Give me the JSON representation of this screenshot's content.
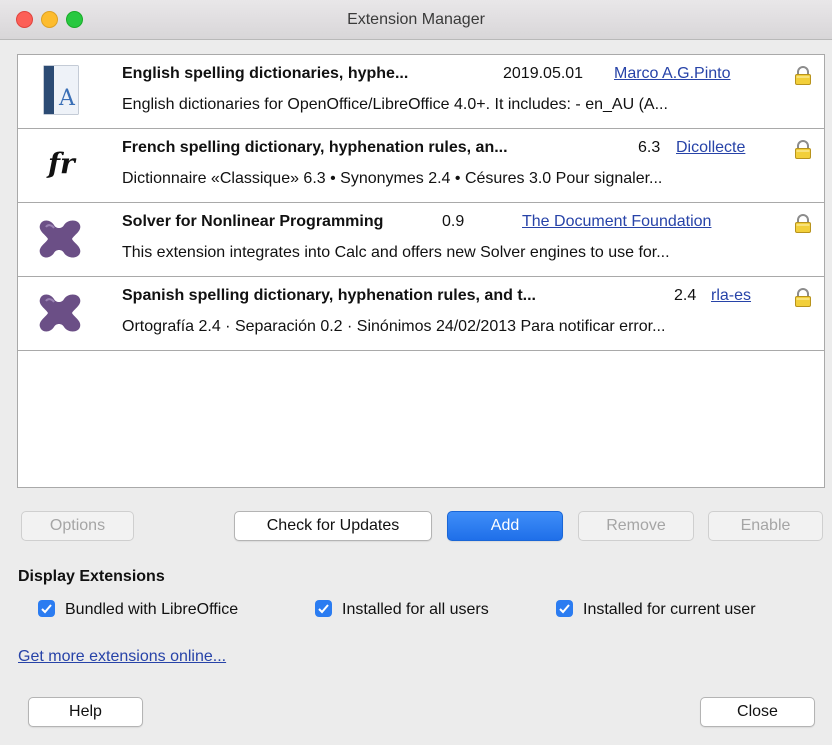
{
  "window": {
    "title": "Extension Manager"
  },
  "extensions": [
    {
      "name": "English spelling dictionaries, hyphe...",
      "version": "2019.05.01",
      "publisher": "Marco A.G.Pinto",
      "description": "English dictionaries for OpenOffice/LibreOffice 4.0+.  It includes: - en_AU (A...",
      "icon": "book-icon"
    },
    {
      "name": "French spelling dictionary, hyphenation rules, an...",
      "version": "6.3",
      "publisher": "Dicollecte",
      "description": "Dictionnaire «Classique» 6.3 • Synonymes 2.4 • Césures 3.0  Pour signaler...",
      "icon": "fr-icon",
      "icon_text": "fr"
    },
    {
      "name": "Solver for Nonlinear Programming",
      "version": "0.9",
      "publisher": "The Document Foundation",
      "description": "This extension integrates into Calc and offers new Solver engines to use for...",
      "icon": "puzzle-icon"
    },
    {
      "name": "Spanish spelling dictionary, hyphenation rules, and t...",
      "version": "2.4",
      "publisher": "rla-es",
      "description": "Ortografía 2.4 · Separación 0.2 · Sinónimos 24/02/2013  Para notificar error...",
      "icon": "puzzle-icon"
    }
  ],
  "buttons": {
    "options": "Options",
    "check_updates": "Check for Updates",
    "add": "Add",
    "remove": "Remove",
    "enable": "Enable",
    "help": "Help",
    "close": "Close"
  },
  "display": {
    "title": "Display Extensions",
    "bundled": "Bundled with LibreOffice",
    "all_users": "Installed for all users",
    "current_user": "Installed for current user"
  },
  "link": "Get more extensions online...",
  "colors": {
    "accent": "#2b7cf1",
    "link": "#2743a8",
    "puzzle": "#6b4f86"
  }
}
